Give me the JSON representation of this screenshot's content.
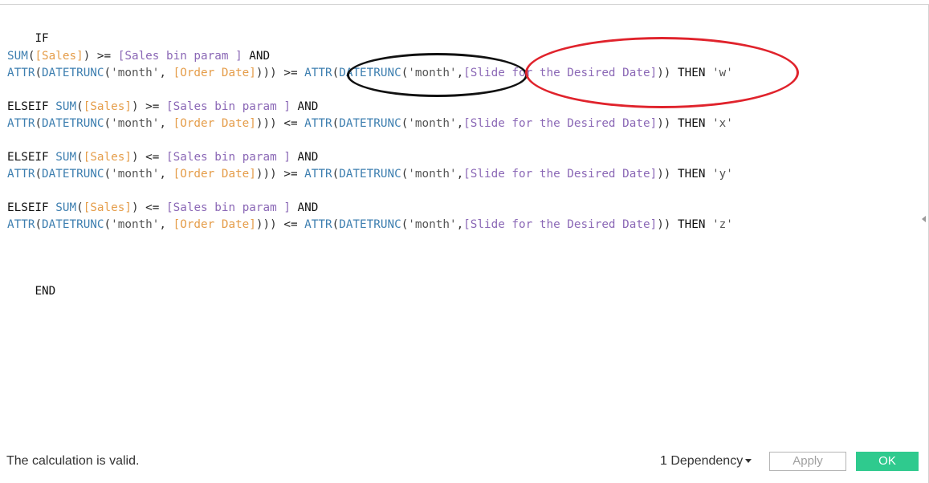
{
  "editor": {
    "lines": [
      {
        "tokens": [
          "IF"
        ]
      },
      {
        "tokens": [
          "SUM",
          "(",
          "[Sales]",
          ")",
          " >= ",
          "[Sales bin param ]",
          " AND"
        ]
      },
      {
        "tokens": [
          "ATTR",
          "(",
          "DATETRUNC",
          "(",
          "'month'",
          ", ",
          "[Order Date]",
          ")))",
          " >= ",
          "ATTR",
          "(",
          "DATETRUNC",
          "(",
          "'month'",
          ",",
          "[Slide for the Desired Date]",
          "))",
          " THEN ",
          "'w'"
        ]
      },
      {
        "tokens": [
          "ELSEIF ",
          "SUM",
          "(",
          "[Sales]",
          ")",
          " >= ",
          "[Sales bin param ]",
          " AND"
        ]
      },
      {
        "tokens": [
          "ATTR",
          "(",
          "DATETRUNC",
          "(",
          "'month'",
          ", ",
          "[Order Date]",
          ")))",
          " <= ",
          "ATTR",
          "(",
          "DATETRUNC",
          "(",
          "'month'",
          ",",
          "[Slide for the Desired Date]",
          "))",
          " THEN ",
          "'x'"
        ]
      },
      {
        "tokens": [
          "ELSEIF ",
          "SUM",
          "(",
          "[Sales]",
          ")",
          " <= ",
          "[Sales bin param ]",
          " AND"
        ]
      },
      {
        "tokens": [
          "ATTR",
          "(",
          "DATETRUNC",
          "(",
          "'month'",
          ", ",
          "[Order Date]",
          ")))",
          " >= ",
          "ATTR",
          "(",
          "DATETRUNC",
          "(",
          "'month'",
          ",",
          "[Slide for the Desired Date]",
          "))",
          " THEN ",
          "'y'"
        ]
      },
      {
        "tokens": [
          "ELSEIF ",
          "SUM",
          "(",
          "[Sales]",
          ")",
          " <= ",
          "[Sales bin param ]",
          " AND"
        ]
      },
      {
        "tokens": [
          "ATTR",
          "(",
          "DATETRUNC",
          "(",
          "'month'",
          ", ",
          "[Order Date]",
          ")))",
          " <= ",
          "ATTR",
          "(",
          "DATETRUNC",
          "(",
          "'month'",
          ",",
          "[Slide for the Desired Date]",
          "))",
          " THEN ",
          "'z'"
        ]
      },
      {
        "tokens": [
          "END"
        ]
      }
    ]
  },
  "annotations": {
    "black_ellipse_color": "#111111",
    "red_ellipse_color": "#e0232c"
  },
  "footer": {
    "status": "The calculation is valid.",
    "dependency_label": "1 Dependency",
    "apply_label": "Apply",
    "ok_label": "OK"
  },
  "colors": {
    "keyword": "#111111",
    "function": "#3e7fb0",
    "field": "#e59d4a",
    "parameter": "#8b68b6",
    "ok_button": "#2fca8e"
  }
}
